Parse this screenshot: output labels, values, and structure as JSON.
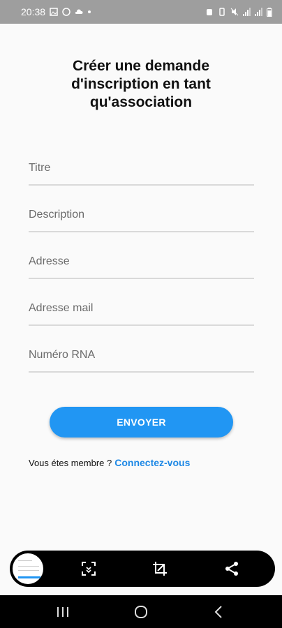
{
  "status_bar": {
    "time": "20:38",
    "battery_icon": "battery-icon",
    "signal_icon": "signal-icon"
  },
  "page": {
    "title_line1": "Créer une demande",
    "title_line2": "d'inscription en tant",
    "title_line3": "qu'association"
  },
  "form": {
    "fields": [
      {
        "placeholder": "Titre"
      },
      {
        "placeholder": "Description"
      },
      {
        "placeholder": "Adresse"
      },
      {
        "placeholder": "Adresse mail"
      },
      {
        "placeholder": "Numéro RNA"
      }
    ],
    "submit_label": "ENVOYER"
  },
  "footer": {
    "member_text": "Vous étes membre ?",
    "login_link": "Connectez-vous"
  },
  "colors": {
    "accent": "#2196f3",
    "link": "#1e88e5",
    "status_bar": "#9e9e9e",
    "background": "#fafafa"
  },
  "screenshot_toolbar": {
    "icons": [
      "scroll-capture-icon",
      "crop-edit-icon",
      "share-icon"
    ]
  },
  "nav_bar": {
    "icons": [
      "recents-icon",
      "home-icon",
      "back-icon"
    ]
  }
}
